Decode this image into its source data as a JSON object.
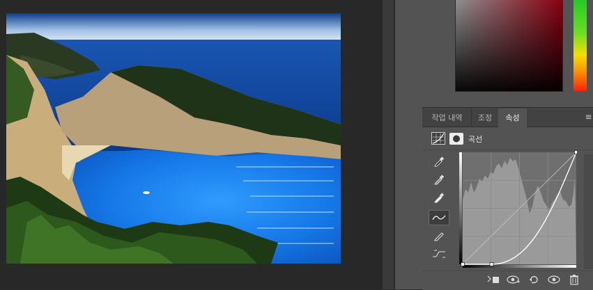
{
  "colors": {
    "accent": "#535353",
    "canvas_bg": "#282828",
    "tab_bar": "#424242"
  },
  "document": {
    "image_description": ""
  },
  "color_picker": {
    "base_hue": "#8a0010"
  },
  "panel": {
    "tabs": [
      {
        "label": "작업 내역",
        "active": false
      },
      {
        "label": "조정",
        "active": false
      },
      {
        "label": "속성",
        "active": true
      }
    ],
    "menu_glyph": "≡"
  },
  "properties": {
    "title": "곡선",
    "header_icons": [
      "curves-adjustment-icon",
      "mask-icon"
    ]
  },
  "curve_tools": [
    {
      "name": "eyedropper-black-icon",
      "active": false
    },
    {
      "name": "eyedropper-gray-icon",
      "active": false
    },
    {
      "name": "eyedropper-white-icon",
      "active": false
    },
    {
      "name": "curve-point-icon",
      "active": true
    },
    {
      "name": "pencil-icon",
      "active": false
    },
    {
      "name": "smooth-curve-icon",
      "active": false
    }
  ],
  "curve": {
    "input_range": [
      0,
      255
    ],
    "output_range": [
      0,
      255
    ],
    "points": [
      [
        0,
        0
      ],
      [
        65,
        0
      ],
      [
        255,
        255
      ]
    ]
  },
  "bottom_icons": [
    "clip-to-layer-icon",
    "view-previous-state-icon",
    "reset-icon",
    "visibility-eye-icon",
    "trash-icon"
  ]
}
